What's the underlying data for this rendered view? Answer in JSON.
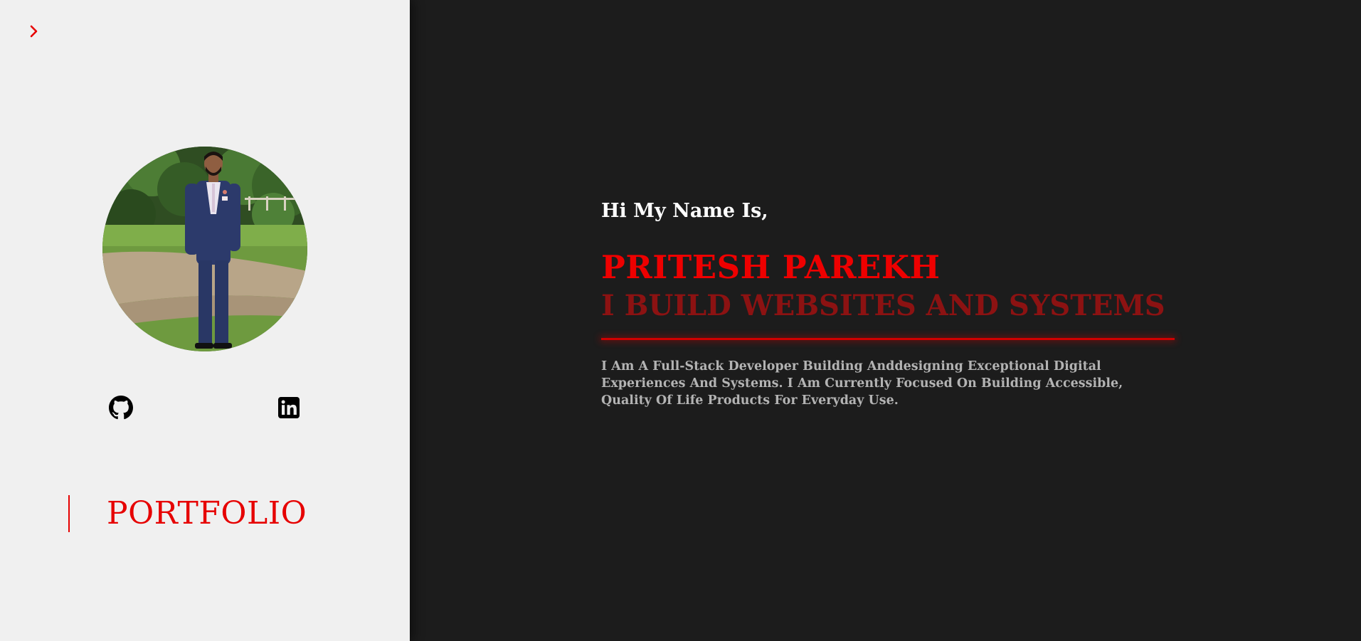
{
  "sidebar": {
    "expand_icon": "chevron-right-icon",
    "avatar_alt": "Profile photo",
    "social": [
      {
        "name": "github",
        "icon": "github-icon"
      },
      {
        "name": "linkedin",
        "icon": "linkedin-icon"
      }
    ],
    "nav_label": "PORTFOLIO"
  },
  "main": {
    "greeting": "Hi My Name Is,",
    "name": "PRITESH PAREKH",
    "tagline": "I BUILD WEBSITES AND SYSTEMS",
    "description": "I Am A Full-Stack Developer Building Anddesigning Exceptional Digital Experiences And Systems. I Am Currently Focused On Building Accessible, Quality Of Life Products For Everyday Use."
  },
  "colors": {
    "accent": "#e60000",
    "tagline": "#8c1212",
    "sidebar_bg": "#f0f0f0",
    "main_bg": "#1c1c1c",
    "description_text": "#b3b3b3"
  }
}
